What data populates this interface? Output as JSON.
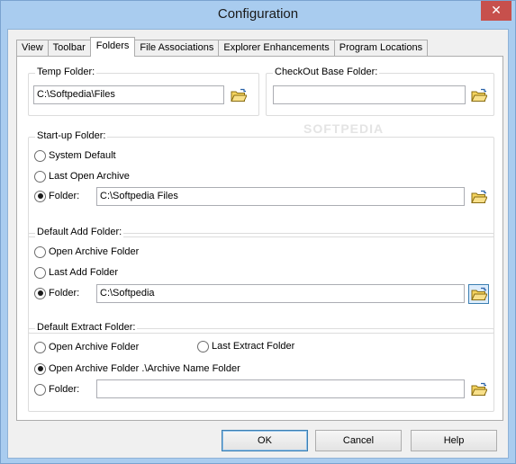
{
  "window": {
    "title": "Configuration",
    "close_glyph": "✕"
  },
  "tabs": [
    {
      "label": "View"
    },
    {
      "label": "Toolbar"
    },
    {
      "label": "Folders"
    },
    {
      "label": "File Associations"
    },
    {
      "label": "Explorer Enhancements"
    },
    {
      "label": "Program Locations"
    }
  ],
  "watermark": "SOFTPEDIA",
  "temp_folder": {
    "label": "Temp Folder:",
    "value": "C:\\Softpedia\\Files"
  },
  "checkout_folder": {
    "label": "CheckOut Base Folder:",
    "value": ""
  },
  "startup_folder": {
    "label": "Start-up Folder:",
    "options": [
      "System Default",
      "Last Open Archive",
      "Folder:"
    ],
    "selected": "Folder:",
    "value": "C:\\Softpedia Files"
  },
  "default_add_folder": {
    "label": "Default Add Folder:",
    "options": [
      "Open Archive Folder",
      "Last Add Folder",
      "Folder:"
    ],
    "selected": "Folder:",
    "value": "C:\\Softpedia"
  },
  "default_extract_folder": {
    "label": "Default Extract Folder:",
    "options": [
      "Open Archive Folder",
      "Last Extract Folder",
      "Open Archive Folder .\\Archive Name Folder",
      "Folder:"
    ],
    "selected": "Open Archive Folder .\\Archive Name Folder",
    "value": ""
  },
  "buttons": {
    "ok": "OK",
    "cancel": "Cancel",
    "help": "Help"
  },
  "icons": {
    "browse": "folder-browse-icon"
  },
  "colors": {
    "titlebar": "#a9ccef",
    "close": "#c7504c",
    "focus": "#3c7fb1"
  }
}
